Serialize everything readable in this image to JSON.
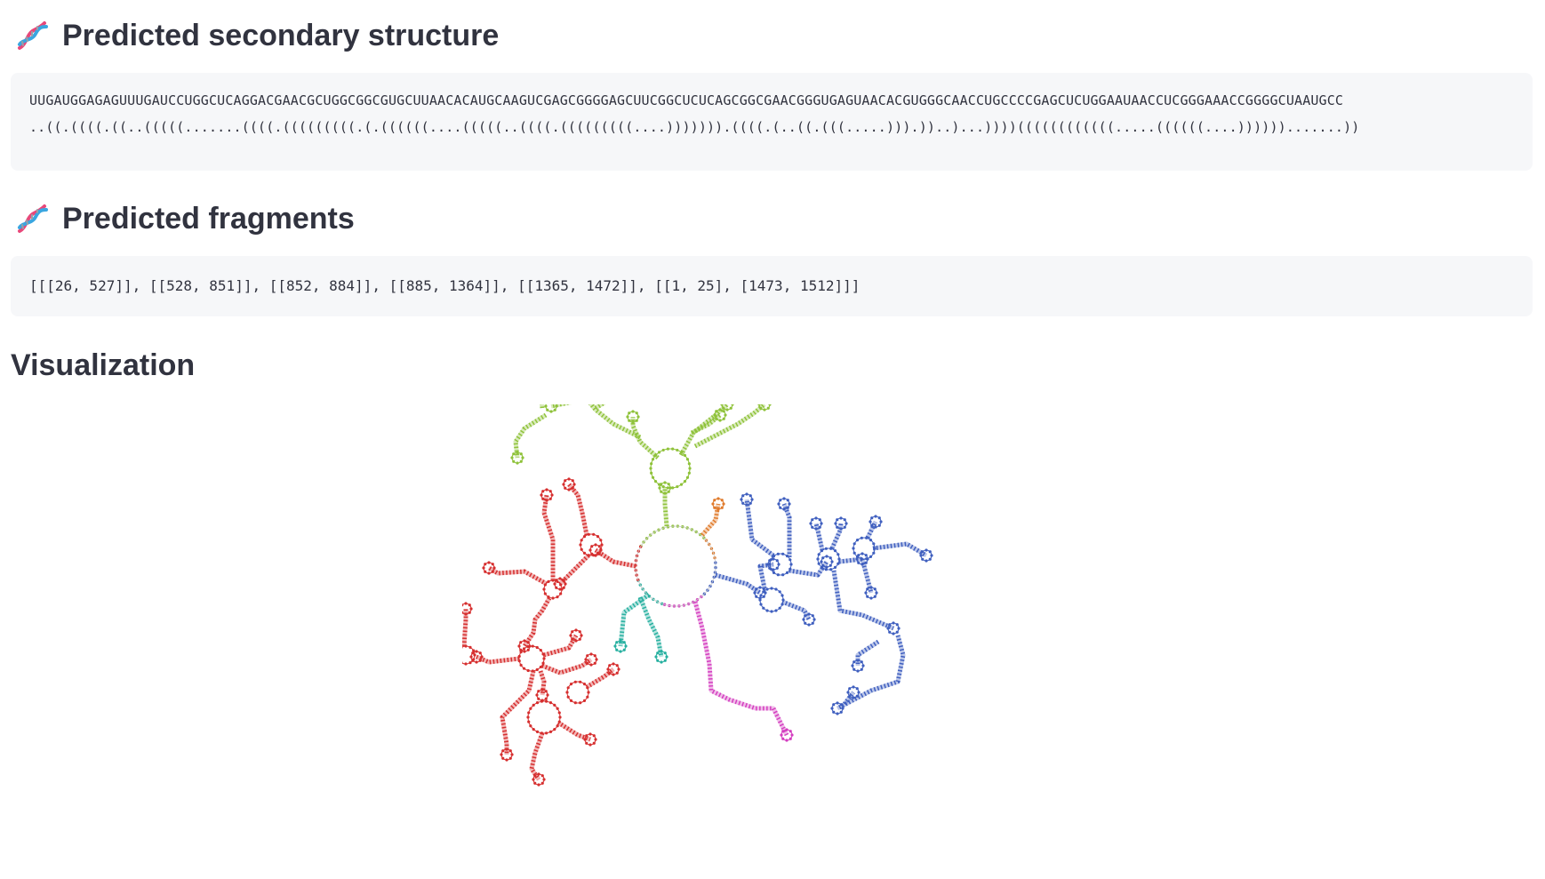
{
  "sections": {
    "structure": {
      "title": "Predicted secondary structure",
      "icon": "dna-icon",
      "sequence": "UUGAUGGAGAGUUUGAUCCUGGCUCAGGACGAACGCUGGCGGCGUGCUUAACACAUGCAAGUCGAGCGGGGAGCUUCGGCUCUCAGCGGCGAACGGGUGAGUAACACGUGGGCAACCUGCCCCGAGCUCUGGAAUAACCUCGGGAAACCGGGGCUAAUGCC",
      "dotbracket": "..((.((((.((..(((((.......((((.(((((((((.(.((((((....(((((..((((.(((((((((....))))))).((((.(..((.(((.....))).))..)...))))((((((((((((.....((((((....)))))).......))"
    },
    "fragments": {
      "title": "Predicted fragments",
      "icon": "dna-icon",
      "value": "[[[26, 527]], [[528, 851]], [[852, 884]], [[885, 1364]], [[1365, 1472]], [[1, 25], [1473, 1512]]]"
    },
    "visualization": {
      "title": "Visualization"
    }
  },
  "colors": {
    "heading": "#31333f",
    "codebox_bg": "#f6f7f9",
    "fragment_1": "#d62f2f",
    "fragment_2": "#8fc23a",
    "fragment_3": "#e07b2c",
    "fragment_4": "#3f5fbf",
    "fragment_5": "#d43fc0",
    "fragment_6": "#27b0a0"
  }
}
